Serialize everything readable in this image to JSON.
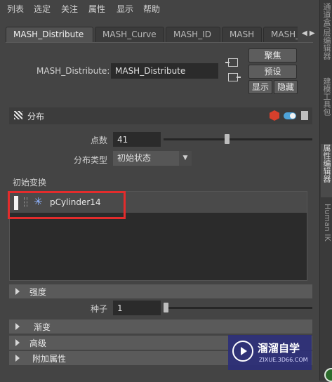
{
  "menu": [
    "列表",
    "选定",
    "关注",
    "属性",
    "显示",
    "帮助"
  ],
  "tabs": [
    "MASH_Distribute",
    "MASH_Curve",
    "MASH_ID",
    "MASH",
    "MASH_R"
  ],
  "node": {
    "label": "MASH_Distribute:",
    "value": "MASH_Distribute"
  },
  "buttons": {
    "focus": "聚焦",
    "presets": "预设",
    "show": "显示",
    "hide": "隐藏"
  },
  "section": {
    "title": "分布"
  },
  "point_count": {
    "label": "点数",
    "value": "41",
    "slider_fraction": 0.41
  },
  "distribution_type": {
    "label": "分布类型",
    "value": "初始状态"
  },
  "initial_transform": {
    "label": "初始变换",
    "items": [
      "pCylinder14"
    ]
  },
  "frames": {
    "strength": "强度",
    "gradient": "渐变",
    "advanced": "高级",
    "extra_attributes": "附加属性"
  },
  "seed": {
    "label": "种子",
    "value": "1",
    "slider_fraction": 0.0
  },
  "dock_tabs": [
    "通道盒/层编辑器",
    "建模工具包",
    "属性编辑器",
    "Human IK"
  ],
  "watermark": {
    "name": "溜溜自学",
    "url": "ZIXUE.3D66.COM"
  },
  "colors": {
    "background": "#444444",
    "field": "#2b2b2b",
    "highlight": "#e32c2c",
    "toggle": "#4ea3d9"
  }
}
